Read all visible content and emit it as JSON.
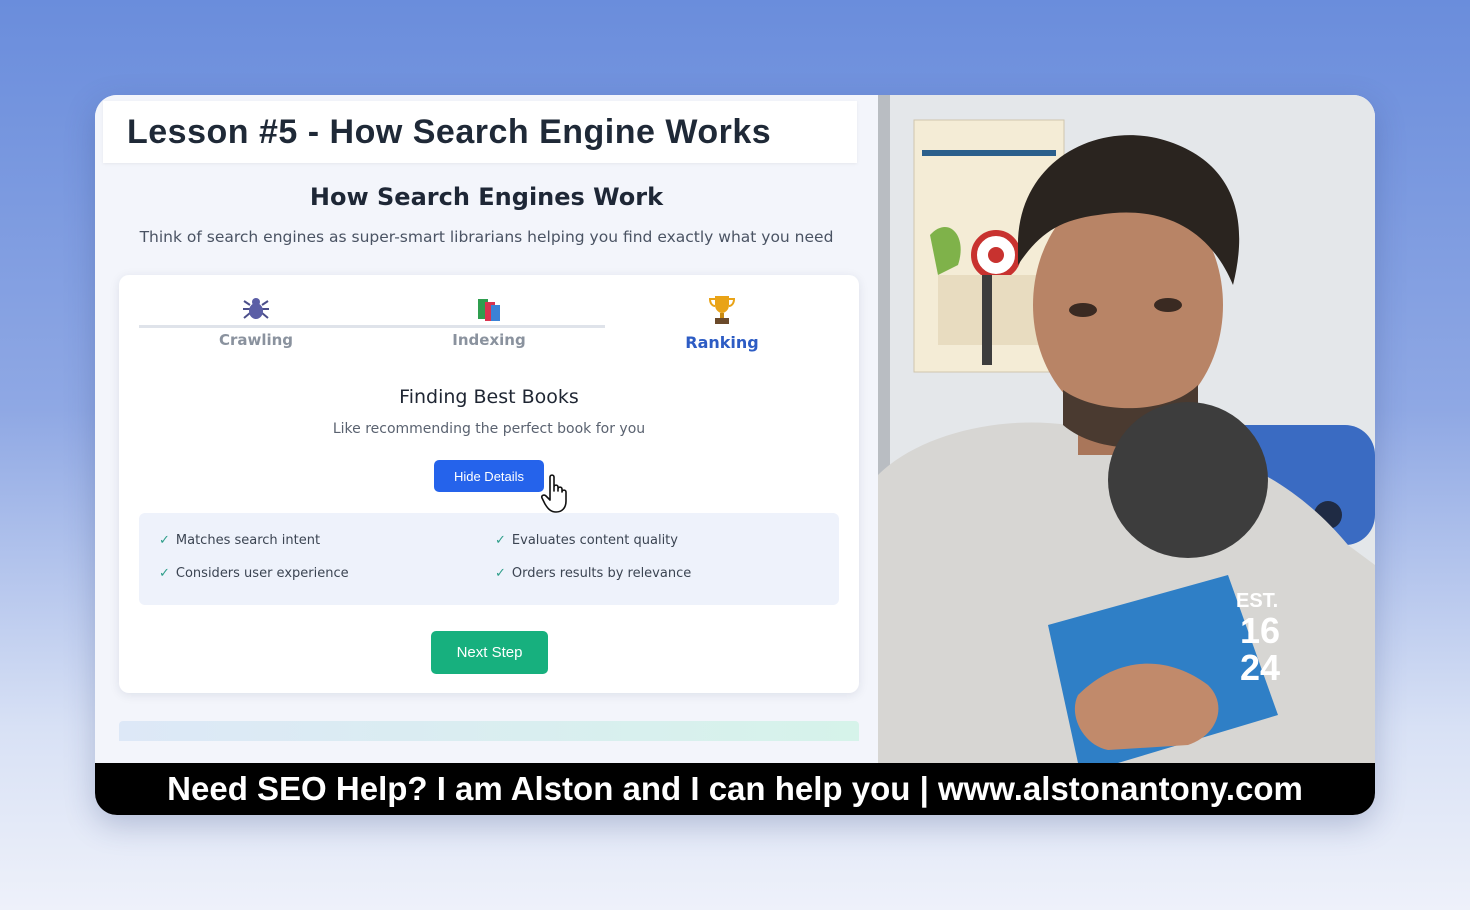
{
  "lesson": {
    "title": "Lesson #5 - How Search Engine Works"
  },
  "page": {
    "title": "How Search Engines Work",
    "subtitle": "Think of search engines as super-smart librarians helping you find exactly what you need"
  },
  "steps": [
    {
      "label": "Crawling",
      "icon": "spider-icon"
    },
    {
      "label": "Indexing",
      "icon": "books-icon"
    },
    {
      "label": "Ranking",
      "icon": "trophy-icon",
      "active": true
    }
  ],
  "stage": {
    "title": "Finding Best Books",
    "subtitle": "Like recommending the perfect book for you",
    "toggle_label": "Hide Details"
  },
  "details": [
    "Matches search intent",
    "Evaluates content quality",
    "Considers user experience",
    "Orders results by relevance"
  ],
  "next_label": "Next Step",
  "caption": "Need SEO Help? I am Alston and I can help you | www.alstonantony.com",
  "colors": {
    "accent": "#2563eb",
    "success": "#17b07e",
    "active_step": "#2d5cc4"
  }
}
